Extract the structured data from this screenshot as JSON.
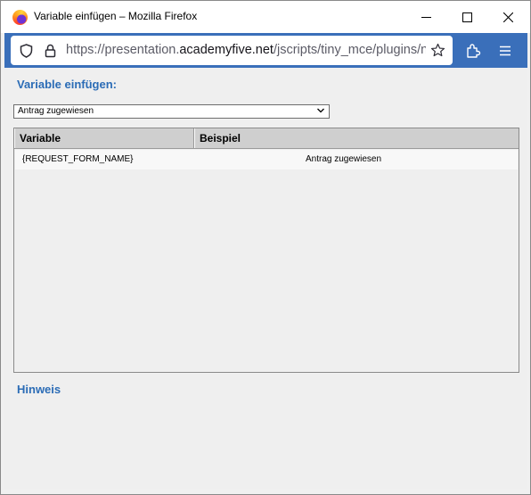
{
  "window": {
    "title": "Variable einfügen – Mozilla Firefox"
  },
  "browser": {
    "url_prefix": "https://presentation.",
    "url_host": "academyfive.net",
    "url_suffix": "/jscripts/tiny_mce/plugins/new"
  },
  "dialog": {
    "heading": "Variable einfügen:",
    "select": {
      "selected": "Antrag zugewiesen"
    },
    "table": {
      "columns": [
        "Variable",
        "Beispiel"
      ],
      "rows": [
        {
          "variable": "{REQUEST_FORM_NAME}",
          "beispiel": "Antrag zugewiesen"
        }
      ]
    },
    "hint_label": "Hinweis"
  },
  "colors": {
    "toolbar": "#3a6fba",
    "heading": "#2b6cb6"
  },
  "icons": [
    "firefox-logo",
    "minimize-icon",
    "maximize-icon",
    "close-icon",
    "shield-icon",
    "lock-icon",
    "star-icon",
    "extensions-icon",
    "menu-icon",
    "chevron-down-icon"
  ]
}
